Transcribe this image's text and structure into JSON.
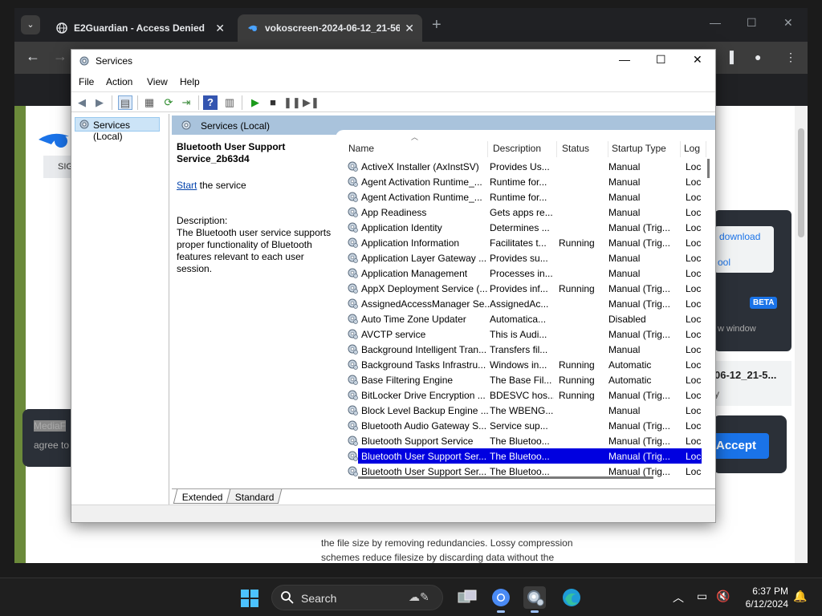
{
  "browser": {
    "tabs": [
      {
        "title": "E2Guardian - Access Denied",
        "close": "✕"
      },
      {
        "title": "vokoscreen-2024-06-12_21-56",
        "close": "✕"
      }
    ],
    "new_tab": "+",
    "min": "—",
    "max": "☐",
    "close": "✕"
  },
  "page": {
    "sign_in": "SIG",
    "cookie_text1": "MediaF",
    "cookie_text2": "agree to",
    "download": "download",
    "tool": "ool",
    "beta": "BETA",
    "new_window": "w window",
    "file_title": "06-12_21-5...",
    "y": "y",
    "accept": "Accept",
    "article": "the file size by removing redundancies. Lossy compression schemes reduce filesize by discarding data without the viewer noticing. The Advanced Video"
  },
  "services_window": {
    "title": "Services",
    "menu": [
      "File",
      "Action",
      "View",
      "Help"
    ],
    "tree_node": "Services (Local)",
    "header": "Services (Local)",
    "detail": {
      "name": "Bluetooth User Support Service_2b63d4",
      "start_link": "Start",
      "start_rest": " the service",
      "desc_label": "Description:",
      "desc_text": "The Bluetooth user service supports proper functionality of Bluetooth features relevant to each user session."
    },
    "columns": [
      "Name",
      "Description",
      "Status",
      "Startup Type",
      "Log"
    ],
    "rows": [
      [
        "ActiveX Installer (AxInstSV)",
        "Provides Us...",
        "",
        "Manual",
        "Loc"
      ],
      [
        "Agent Activation Runtime_...",
        "Runtime for...",
        "",
        "Manual",
        "Loc"
      ],
      [
        "Agent Activation Runtime_...",
        "Runtime for...",
        "",
        "Manual",
        "Loc"
      ],
      [
        "App Readiness",
        "Gets apps re...",
        "",
        "Manual",
        "Loc"
      ],
      [
        "Application Identity",
        "Determines ...",
        "",
        "Manual (Trig...",
        "Loc"
      ],
      [
        "Application Information",
        "Facilitates t...",
        "Running",
        "Manual (Trig...",
        "Loc"
      ],
      [
        "Application Layer Gateway ...",
        "Provides su...",
        "",
        "Manual",
        "Loc"
      ],
      [
        "Application Management",
        "Processes in...",
        "",
        "Manual",
        "Loc"
      ],
      [
        "AppX Deployment Service (...",
        "Provides inf...",
        "Running",
        "Manual (Trig...",
        "Loc"
      ],
      [
        "AssignedAccessManager Se...",
        "AssignedAc...",
        "",
        "Manual (Trig...",
        "Loc"
      ],
      [
        "Auto Time Zone Updater",
        "Automatica...",
        "",
        "Disabled",
        "Loc"
      ],
      [
        "AVCTP service",
        "This is Audi...",
        "",
        "Manual (Trig...",
        "Loc"
      ],
      [
        "Background Intelligent Tran...",
        "Transfers fil...",
        "",
        "Manual",
        "Loc"
      ],
      [
        "Background Tasks Infrastru...",
        "Windows in...",
        "Running",
        "Automatic",
        "Loc"
      ],
      [
        "Base Filtering Engine",
        "The Base Fil...",
        "Running",
        "Automatic",
        "Loc"
      ],
      [
        "BitLocker Drive Encryption ...",
        "BDESVC hos...",
        "Running",
        "Manual (Trig...",
        "Loc"
      ],
      [
        "Block Level Backup Engine ...",
        "The WBENG...",
        "",
        "Manual",
        "Loc"
      ],
      [
        "Bluetooth Audio Gateway S...",
        "Service sup...",
        "",
        "Manual (Trig...",
        "Loc"
      ],
      [
        "Bluetooth Support Service",
        "The Bluetoo...",
        "",
        "Manual (Trig...",
        "Loc"
      ],
      [
        "Bluetooth User Support Ser...",
        "The Bluetoo...",
        "",
        "Manual (Trig...",
        "Loc"
      ],
      [
        "Bluetooth User Support Ser...",
        "The Bluetoo...",
        "",
        "Manual (Trig...",
        "Loc"
      ]
    ],
    "selected_row": 19,
    "tabs": [
      "Extended",
      "Standard"
    ]
  },
  "taskbar": {
    "search": "Search",
    "time": "6:37 PM",
    "date": "6/12/2024"
  },
  "colors": {
    "selection": "#0000e0",
    "header_band": "#a9c3dc",
    "accent": "#1a73e8"
  }
}
